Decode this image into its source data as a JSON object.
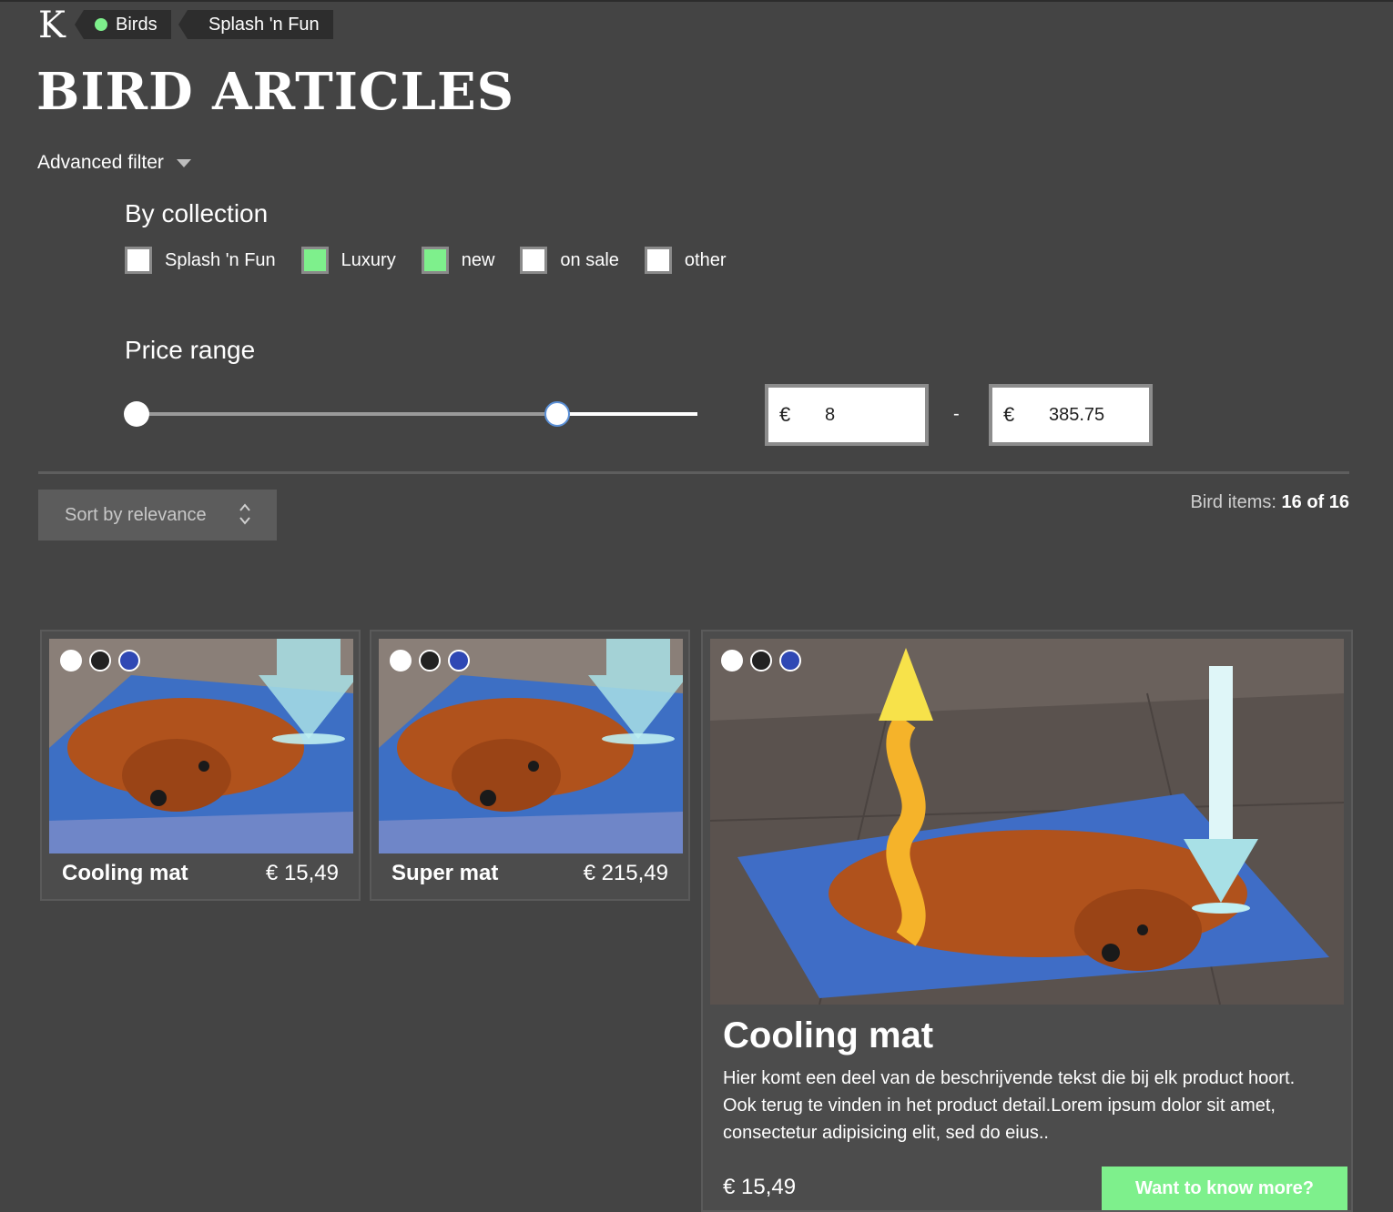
{
  "header": {
    "logo_letter": "K",
    "breadcrumb": [
      {
        "label": "Birds"
      },
      {
        "label": "Splash 'n Fun"
      }
    ]
  },
  "page_title": "BIRD ARTICLES",
  "filter": {
    "toggle_label": "Advanced filter",
    "collection": {
      "title": "By collection",
      "options": [
        {
          "label": "Splash 'n Fun",
          "checked": false
        },
        {
          "label": "Luxury",
          "checked": true
        },
        {
          "label": "new",
          "checked": true
        },
        {
          "label": "on sale",
          "checked": false
        },
        {
          "label": "other",
          "checked": false
        }
      ]
    },
    "price": {
      "title": "Price range",
      "currency": "€",
      "min_value": "8",
      "max_value": "385.75",
      "separator": "-",
      "slider_min_fraction": 0.0,
      "slider_max_fraction": 0.75
    }
  },
  "toolbar": {
    "sort_label": "Sort by relevance",
    "count_label": "Bird items:",
    "count_value": "16 of 16"
  },
  "products": [
    {
      "name": "Cooling mat",
      "price": "€ 15,49",
      "swatches": [
        "#ffffff",
        "#222222",
        "#2f48b4"
      ]
    },
    {
      "name": "Super mat",
      "price": "€ 215,49",
      "swatches": [
        "#ffffff",
        "#222222",
        "#2f48b4"
      ]
    },
    {
      "name": "Cooling mat",
      "description": "Hier komt een deel van de beschrijvende tekst die bij elk product hoort. Ook terug te vinden in het product detail.Lorem ipsum dolor sit amet, consectetur adipisicing elit, sed do eius..",
      "price": "€ 15,49",
      "cta": "Want to know more?",
      "swatches": [
        "#ffffff",
        "#222222",
        "#2f48b4"
      ]
    }
  ],
  "colors": {
    "accent": "#7ef08c",
    "background": "#444444",
    "card_background": "#4c4c4c"
  }
}
